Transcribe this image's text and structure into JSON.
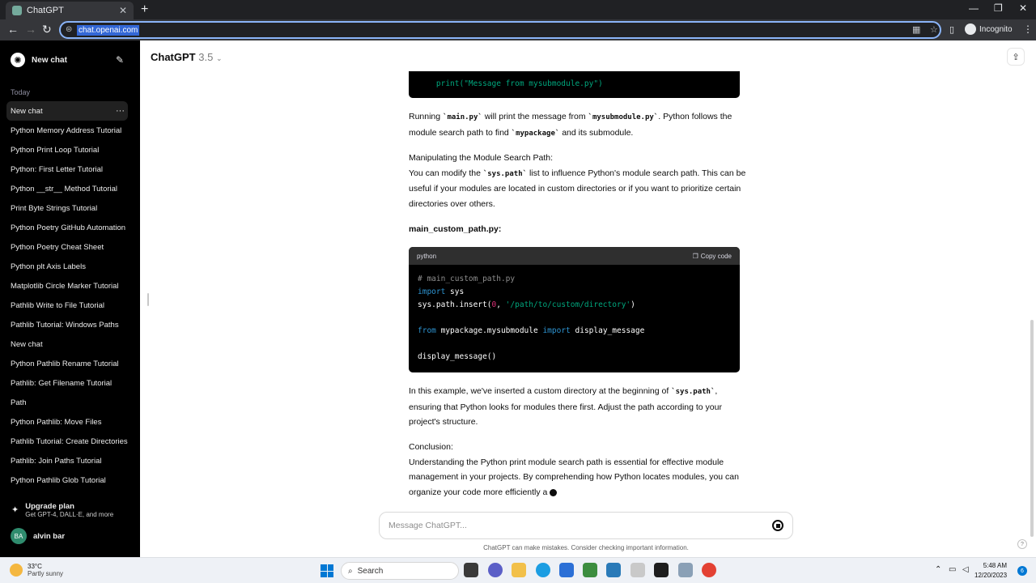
{
  "browser": {
    "tab_title": "ChatGPT",
    "url": "chat.openai.com",
    "incognito_label": "Incognito"
  },
  "sidebar": {
    "new_chat_label": "New chat",
    "section_label": "Today",
    "items": [
      {
        "label": "New chat"
      },
      {
        "label": "Python Memory Address Tutorial"
      },
      {
        "label": "Python Print Loop Tutorial"
      },
      {
        "label": "Python: First Letter Tutorial"
      },
      {
        "label": "Python __str__ Method Tutorial"
      },
      {
        "label": "Print Byte Strings Tutorial"
      },
      {
        "label": "Python Poetry GitHub Automation"
      },
      {
        "label": "Python Poetry Cheat Sheet"
      },
      {
        "label": "Python plt Axis Labels"
      },
      {
        "label": "Matplotlib Circle Marker Tutorial"
      },
      {
        "label": "Pathlib Write to File Tutorial"
      },
      {
        "label": "Pathlib Tutorial: Windows Paths"
      },
      {
        "label": "New chat"
      },
      {
        "label": "Python Pathlib Rename Tutorial"
      },
      {
        "label": "Pathlib: Get Filename Tutorial"
      },
      {
        "label": "Path"
      },
      {
        "label": "Python Pathlib: Move Files"
      },
      {
        "label": "Pathlib Tutorial: Create Directories"
      },
      {
        "label": "Pathlib: Join Paths Tutorial"
      },
      {
        "label": "Python Pathlib Glob Tutorial"
      }
    ],
    "upgrade_title": "Upgrade plan",
    "upgrade_sub": "Get GPT-4, DALL·E, and more",
    "user_initials": "BA",
    "user_name": "alvin bar"
  },
  "header": {
    "model_name": "ChatGPT",
    "model_version": "3.5"
  },
  "conversation": {
    "code1_line": "    print(\"Message from mysubmodule.py\")",
    "p1_pre": "Running ",
    "p1_code1": "`main.py`",
    "p1_mid": " will print the message from ",
    "p1_code2": "`mysubmodule.py`",
    "p1_mid2": ". Python follows the module search path to find ",
    "p1_code3": "`mypackage`",
    "p1_post": " and its submodule.",
    "p2_heading": "Manipulating the Module Search Path:",
    "p2_pre": "You can modify the ",
    "p2_code": "`sys.path`",
    "p2_post": " list to influence Python's module search path. This can be useful if your modules are located in custom directories or if you want to prioritize certain directories over others.",
    "file_heading": "main_custom_path.py:",
    "code2_lang": "python",
    "code2_copy": "Copy code",
    "code2": {
      "comment": "# main_custom_path.py",
      "import_kw": "import",
      "import_mod": " sys",
      "insert_call": "sys.path.insert(",
      "insert_num": "0",
      "insert_sep": ", ",
      "insert_str": "'/path/to/custom/directory'",
      "insert_end": ")",
      "from_kw": "from",
      "from_mod": " mypackage.mysubmodule ",
      "from_import_kw": "import",
      "from_name": " display_message",
      "call": "display_message()"
    },
    "p3_pre": "In this example, we've inserted a custom directory at the beginning of ",
    "p3_code": "`sys.path`",
    "p3_post": ", ensuring that Python looks for modules there first. Adjust the path according to your project's structure.",
    "p4_heading": "Conclusion:",
    "p4_text": "Understanding the Python print module search path is essential for effective module management in your projects. By comprehending how Python locates modules, you can organize your code more efficiently a "
  },
  "composer": {
    "placeholder": "Message ChatGPT...",
    "disclaimer": "ChatGPT can make mistakes. Consider checking important information."
  },
  "taskbar": {
    "temperature": "33°C",
    "weather": "Partly sunny",
    "search_label": "Search",
    "time": "5:48 AM",
    "date": "12/20/2023",
    "notification_count": "6"
  }
}
